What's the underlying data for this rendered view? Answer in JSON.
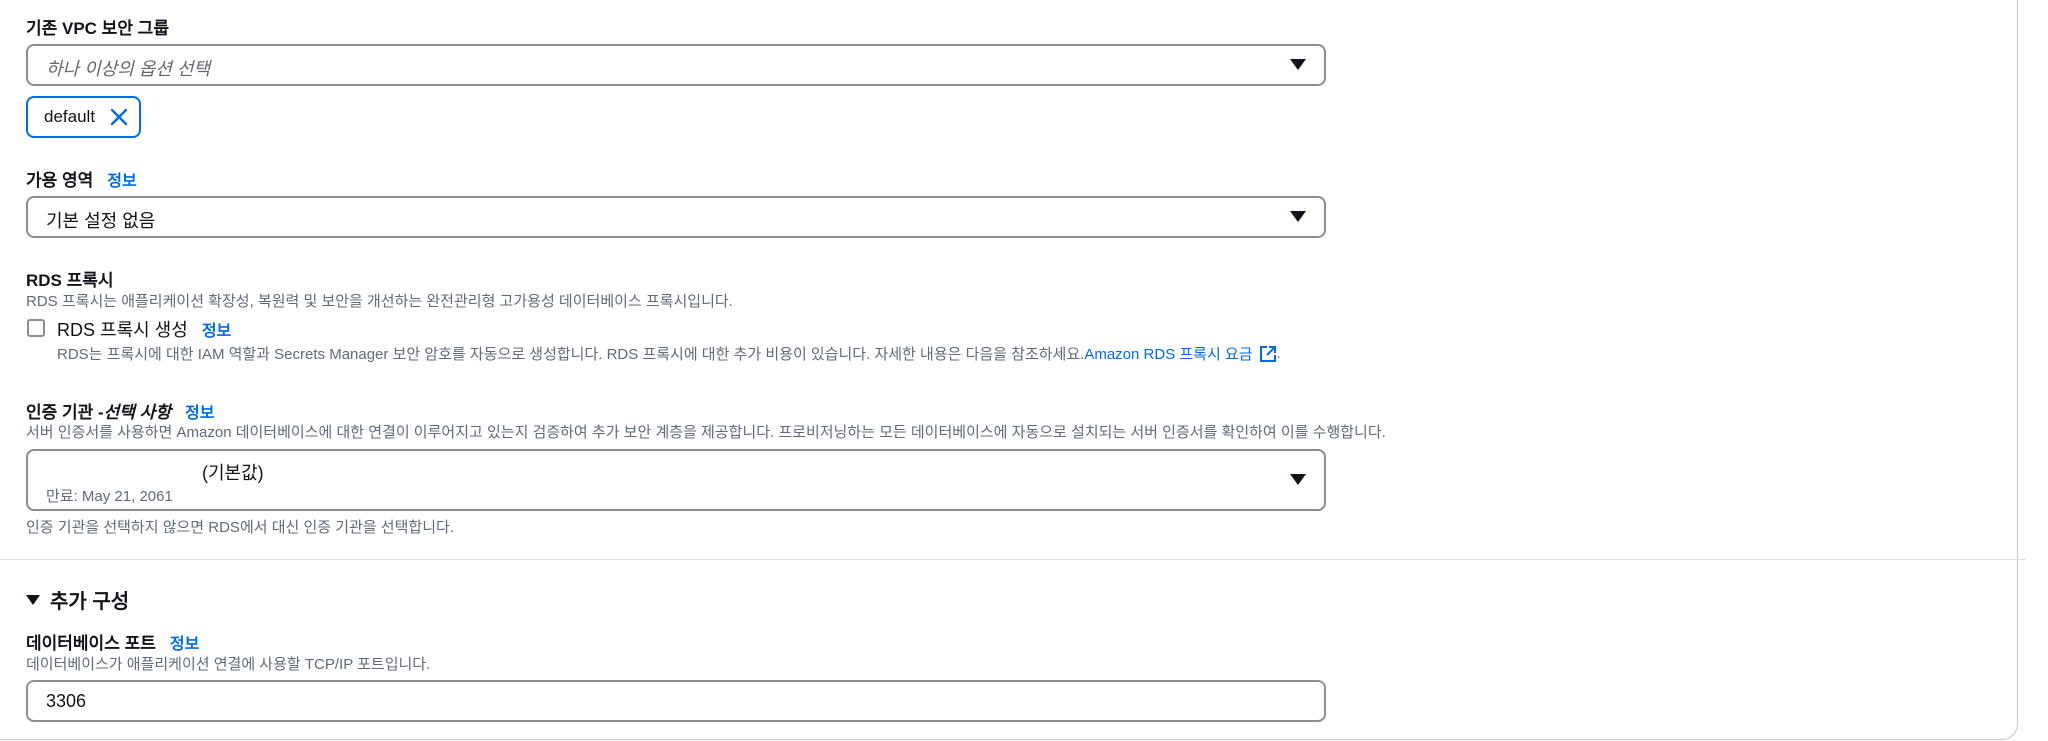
{
  "vpc_security_group": {
    "label": "기존 VPC 보안 그룹",
    "placeholder": "하나 이상의 옵션 선택",
    "token": "default"
  },
  "availability_zone": {
    "label": "가용 영역",
    "info": "정보",
    "value": "기본 설정 없음"
  },
  "rds_proxy": {
    "label": "RDS 프록시",
    "description": "RDS 프록시는 애플리케이션 확장성, 복원력 및 보안을 개선하는 완전관리형 고가용성 데이터베이스 프록시입니다.",
    "checkbox_label": "RDS 프록시 생성",
    "info": "정보",
    "checkbox_checked": false,
    "checkbox_description": "RDS는 프록시에 대한 IAM 역할과 Secrets Manager 보안 암호를 자동으로 생성합니다. RDS 프록시에 대한 추가 비용이 있습니다. 자세한 내용은 다음을 참조하세요.",
    "pricing_link": "Amazon RDS 프록시 요금",
    "pricing_trailing": "."
  },
  "certificate_authority": {
    "label_main": "인증 기관 - ",
    "label_optional": "선택 사항",
    "info": "정보",
    "description": "서버 인증서를 사용하면 Amazon 데이터베이스에 대한 연결이 이루어지고 있는지 검증하여 추가 보안 계층을 제공합니다. 프로비저닝하는 모든 데이터베이스에 자동으로 설치되는 서버 인증서를 확인하여 이를 수행합니다.",
    "selected_suffix": "(기본값)",
    "expiry": "만료: May 21, 2061",
    "hint": "인증 기관을 선택하지 않으면 RDS에서 대신 인증 기관을 선택합니다."
  },
  "additional_config": {
    "toggle_label": "추가 구성"
  },
  "database_port": {
    "label": "데이터베이스 포트",
    "info": "정보",
    "description": "데이터베이스가 애플리케이션 연결에 사용할 TCP/IP 포트입니다.",
    "value": "3306"
  }
}
